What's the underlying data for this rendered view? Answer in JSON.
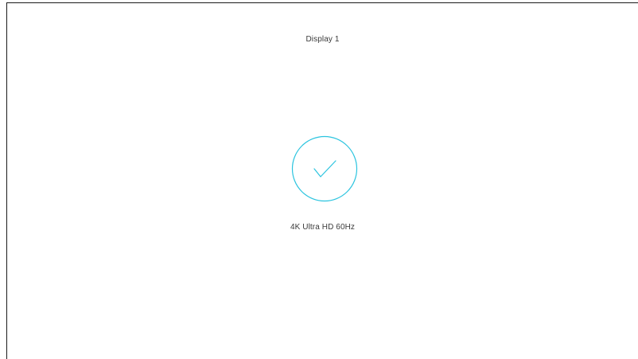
{
  "display": {
    "title": "Display 1",
    "status_icon": "checkmark-circle-icon",
    "resolution": "4K Ultra HD 60Hz"
  },
  "colors": {
    "accent": "#2bc4df",
    "text": "#3a3a3a",
    "background": "#ffffff",
    "frame_border": "#1a1a1a"
  }
}
